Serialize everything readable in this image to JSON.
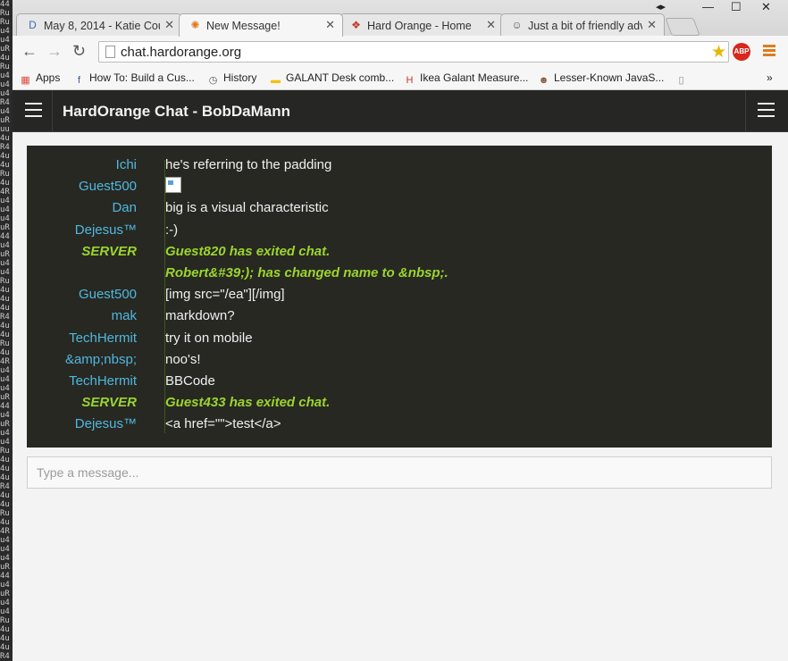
{
  "edge_strip": "44RuRuu4u4uR4uRuu4u4u4R4u4uRuu4uR44u4uRu4u4Ru4u4u4uR44u4uRu4u4Ru4u4u4uR44u4uRu4u4Ru4u4u4uR44u4uRu4u4Ru4u4u4uR44u4uRu4u4Ru4u4u4uR44u4uRu4u4Ru4u4u4uR44u4uRu4u4Ru4u4u4uR44u4uRu4u4Ru4u4u4uR44u4uRu4u4Ru4u4u4uR4",
  "tabs": [
    {
      "icon": "D",
      "icon_color": "#3b6fb6",
      "label": "May 8, 2014 - Katie Cou"
    },
    {
      "icon": "✺",
      "icon_color": "#e07a1f",
      "label": "New Message!"
    },
    {
      "icon": "❖",
      "icon_color": "#c0392b",
      "label": "Hard Orange - Home"
    },
    {
      "icon": "☺",
      "icon_color": "#555555",
      "label": "Just a bit of friendly adv"
    }
  ],
  "window_controls": {
    "minimize": "—",
    "maximize": "☐",
    "close": "✕",
    "profile": "◂▸"
  },
  "toolbar": {
    "back": "←",
    "forward": "→",
    "reload": "↻",
    "url": "chat.hardorange.org",
    "star": "★",
    "abp": "ABP"
  },
  "bookmarks": [
    {
      "icon": "▦",
      "icon_color": "#e04b3a",
      "label": "Apps"
    },
    {
      "icon": "f",
      "icon_color": "#3b5998",
      "label": "How To: Build a Cus..."
    },
    {
      "icon": "◷",
      "icon_color": "#555555",
      "label": "History"
    },
    {
      "icon": "▬",
      "icon_color": "#f4c20d",
      "label": "GALANT Desk comb..."
    },
    {
      "icon": "H",
      "icon_color": "#c0392b",
      "label": "Ikea Galant Measure..."
    },
    {
      "icon": "☻",
      "icon_color": "#8a5a3a",
      "label": "Lesser-Known JavaS..."
    },
    {
      "icon": "▯",
      "icon_color": "#888888",
      "label": ""
    }
  ],
  "bookmarks_overflow": "»",
  "app": {
    "title": "HardOrange Chat - BobDaMann"
  },
  "messages": [
    {
      "nick": "Ichi",
      "text": "he's referring to the padding",
      "server": false
    },
    {
      "nick": "Guest500",
      "text": "",
      "image": true,
      "server": false
    },
    {
      "nick": "Dan",
      "text": "big is a visual characteristic",
      "server": false
    },
    {
      "nick": "Dejesus™",
      "text": ":-)",
      "server": false
    },
    {
      "nick": "SERVER",
      "text": "Guest820 has exited chat.",
      "server": true
    },
    {
      "nick": "",
      "text": "Robert&#39;); has changed name to &nbsp;.",
      "server": true
    },
    {
      "nick": "Guest500",
      "text": "[img src=\"/ea\"][/img]",
      "server": false
    },
    {
      "nick": "mak",
      "text": "markdown?",
      "server": false
    },
    {
      "nick": "TechHermit",
      "text": "try it on mobile",
      "server": false
    },
    {
      "nick": "&amp;nbsp;",
      "text": "noo's!",
      "server": false
    },
    {
      "nick": "TechHermit",
      "text": "BBCode",
      "server": false
    },
    {
      "nick": "SERVER",
      "text": "Guest433 has exited chat.",
      "server": true
    },
    {
      "nick": "Dejesus™",
      "text": "<a href=\"\">test</a>",
      "server": false
    }
  ],
  "composer": {
    "placeholder": "Type a message..."
  }
}
